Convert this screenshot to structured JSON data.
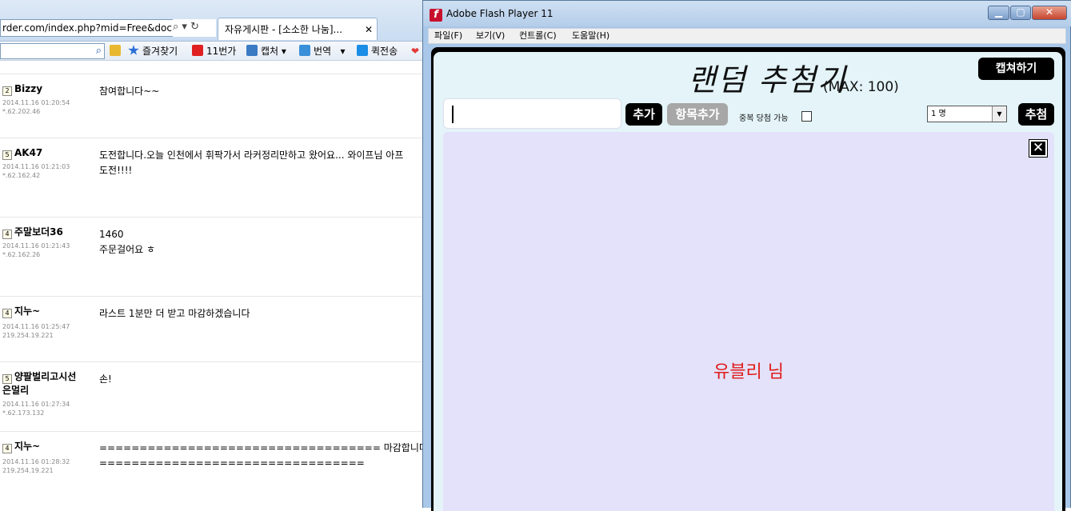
{
  "browser": {
    "address_url": "rder.com/index.php?mid=Free&docume",
    "tab_title": "자유게시판 - [소소한 나눔]...",
    "tab_close": "✕",
    "fav_bar": {
      "items": [
        {
          "label": "즐겨찾기",
          "color": "#2a6fd6"
        },
        {
          "label": "11번가",
          "color": "#e02020"
        },
        {
          "label": "캡처",
          "color": "#3b7bc4",
          "arrow": "▾"
        },
        {
          "label": "번역",
          "color": "#3a8fd9",
          "arrow": "▾"
        },
        {
          "label": "퀵전송",
          "color": "#1a8ee6"
        }
      ]
    },
    "comments": [
      {
        "level": "2",
        "nick": "Bizzy",
        "date": "2014.11.16 01:20:54",
        "ip": "*.62.202.46",
        "text": "참여합니다~~"
      },
      {
        "level": "5",
        "nick": "AK47",
        "date": "2014.11.16 01:21:03",
        "ip": "*.62.162.42",
        "text": "도전합니다.오늘 인천에서 휘팍가서 라커정리만하고 왔어요... 와이프님 아프\n도전!!!!"
      },
      {
        "level": "4",
        "nick": "주말보더36",
        "date": "2014.11.16 01:21:43",
        "ip": "*.62.162.26",
        "text": "1460\n주문걸어요 ㅎ"
      },
      {
        "level": "4",
        "nick": "지누~",
        "date": "2014.11.16 01:25:47",
        "ip": "219.254.19.221",
        "text": "라스트 1분만 더 받고 마감하겠습니다"
      },
      {
        "level": "5",
        "nick": "양팔벌리고시선\n은멀리",
        "date": "2014.11.16 01:27:34",
        "ip": "*.62.173.132",
        "text": "손!"
      },
      {
        "level": "4",
        "nick": "지누~",
        "date": "2014.11.16 01:28:32",
        "ip": "219.254.19.221",
        "text": "=================================== 마감합니다\n================================="
      }
    ]
  },
  "flash": {
    "window_title": "Adobe Flash Player 11",
    "logo_glyph": "f",
    "window_controls": {
      "minimize": "▁",
      "maximize": "▢",
      "close": "✕"
    },
    "menu": [
      "파일(F)",
      "보기(V)",
      "컨트롤(C)",
      "도움말(H)"
    ],
    "app": {
      "title": "랜덤 추첨기",
      "max_note": "(MAX: 100)",
      "capture_label": "캡쳐하기",
      "item_input_value": "",
      "add_label": "추가",
      "add_items_label": "항목추가",
      "duplicate_label": "중복 당첨 가능",
      "duplicate_checked": false,
      "count_selected": "1 명",
      "count_arrow": "▼",
      "draw_label": "추첨",
      "close_glyph": "✕",
      "winner_text": "유블리 님",
      "winner_color": "#e01b1b"
    }
  }
}
